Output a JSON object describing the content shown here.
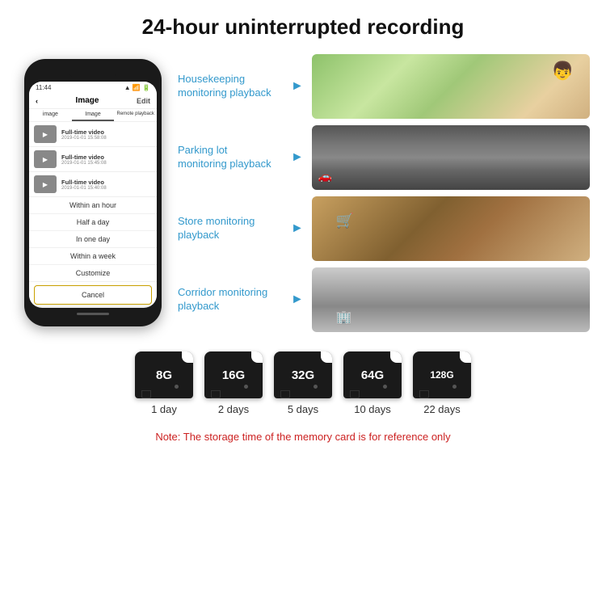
{
  "header": {
    "title": "24-hour uninterrupted recording"
  },
  "phone": {
    "time": "11:44",
    "screen_title": "Image",
    "edit_button": "Edit",
    "tabs": [
      "image",
      "Image",
      "Remote playback"
    ],
    "videos": [
      {
        "title": "Full-time video",
        "date": "2019-01-01 15:58:08"
      },
      {
        "title": "Full-time video",
        "date": "2019-01-01 15:45:08"
      },
      {
        "title": "Full-time video",
        "date": "2019-01-01 15:40:08"
      }
    ],
    "dropdown_items": [
      "Within an hour",
      "Half a day",
      "In one day",
      "Within a week",
      "Customize"
    ],
    "cancel_label": "Cancel"
  },
  "monitoring": [
    {
      "label": "Housekeeping\nmonitoring playback",
      "photo_class": "photo-housekeeping"
    },
    {
      "label": "Parking lot\nmonitoring playback",
      "photo_class": "photo-parking"
    },
    {
      "label": "Store monitoring\nplayback",
      "photo_class": "photo-store"
    },
    {
      "label": "Corridor monitoring\nplayback",
      "photo_class": "photo-corridor"
    }
  ],
  "storage": [
    {
      "size": "8G",
      "days": "1 day"
    },
    {
      "size": "16G",
      "days": "2 days"
    },
    {
      "size": "32G",
      "days": "5 days"
    },
    {
      "size": "64G",
      "days": "10 days"
    },
    {
      "size": "128G",
      "days": "22 days"
    }
  ],
  "note": "Note: The storage time of the memory card is for reference only"
}
